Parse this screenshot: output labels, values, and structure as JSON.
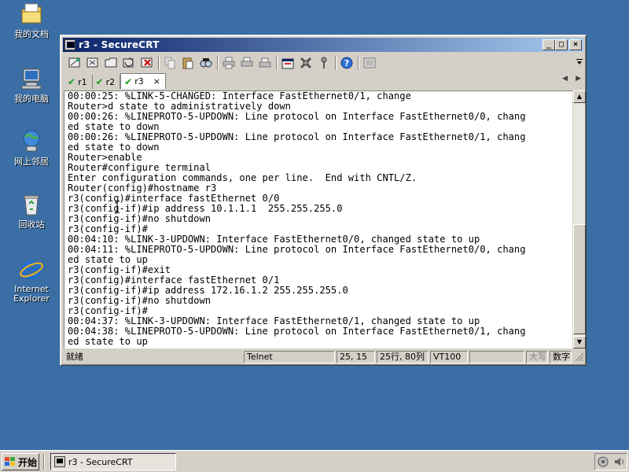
{
  "desktop": {
    "icons": [
      {
        "label": "我的文档",
        "icon": "my-documents-icon"
      },
      {
        "label": "我的电脑",
        "icon": "my-computer-icon"
      },
      {
        "label": "网上邻居",
        "icon": "network-places-icon"
      },
      {
        "label": "回收站",
        "icon": "recycle-bin-icon"
      },
      {
        "label_line1": "Internet",
        "label_line2": "Explorer",
        "icon": "internet-explorer-icon"
      }
    ]
  },
  "window": {
    "title": "r3 - SecureCRT",
    "buttons": {
      "minimize": "_",
      "maximize": "□",
      "close": "×"
    }
  },
  "tabs": [
    {
      "label": "r1",
      "active": false
    },
    {
      "label": "r2",
      "active": false
    },
    {
      "label": "r3",
      "active": true,
      "close": "×"
    }
  ],
  "terminal": {
    "lines": [
      "00:00:25: %LINK-5-CHANGED: Interface FastEthernet0/1, change",
      "Router>d state to administratively down",
      "00:00:26: %LINEPROTO-5-UPDOWN: Line protocol on Interface FastEthernet0/0, chang",
      "ed state to down",
      "00:00:26: %LINEPROTO-5-UPDOWN: Line protocol on Interface FastEthernet0/1, chang",
      "ed state to down",
      "Router>enable",
      "Router#configure terminal",
      "Enter configuration commands, one per line.  End with CNTL/Z.",
      "Router(config)#hostname r3",
      "r3(config)#interface fastEthernet 0/0",
      "r3(config-if)#ip address 10.1.1.1  255.255.255.0",
      "r3(config-if)#no shutdown",
      "r3(config-if)#",
      "00:04:10: %LINK-3-UPDOWN: Interface FastEthernet0/0, changed state to up",
      "00:04:11: %LINEPROTO-5-UPDOWN: Line protocol on Interface FastEthernet0/0, chang",
      "ed state to up",
      "r3(config-if)#exit",
      "r3(config)#interface fastEthernet 0/1",
      "r3(config-if)#ip address 172.16.1.2 255.255.255.0",
      "r3(config-if)#no shutdown",
      "r3(config-if)#",
      "00:04:37: %LINK-3-UPDOWN: Interface FastEthernet0/1, changed state to up",
      "00:04:38: %LINEPROTO-5-UPDOWN: Line protocol on Interface FastEthernet0/1, chang",
      "ed state to up"
    ]
  },
  "statusbar": {
    "ready": "就绪",
    "protocol": "Telnet",
    "cursor": "25, 15",
    "size": "25行, 80列",
    "terminal_type": "VT100",
    "caps": "大写",
    "num": "数字"
  },
  "taskbar": {
    "start_label": "开始",
    "task_title": "r3 - SecureCRT"
  },
  "colors": {
    "desktop": "#3a6ea5",
    "title_active_start": "#0a246a",
    "title_active_end": "#a6caf0",
    "face": "#d4d0c8",
    "tab_check": "#1a9a1a"
  }
}
